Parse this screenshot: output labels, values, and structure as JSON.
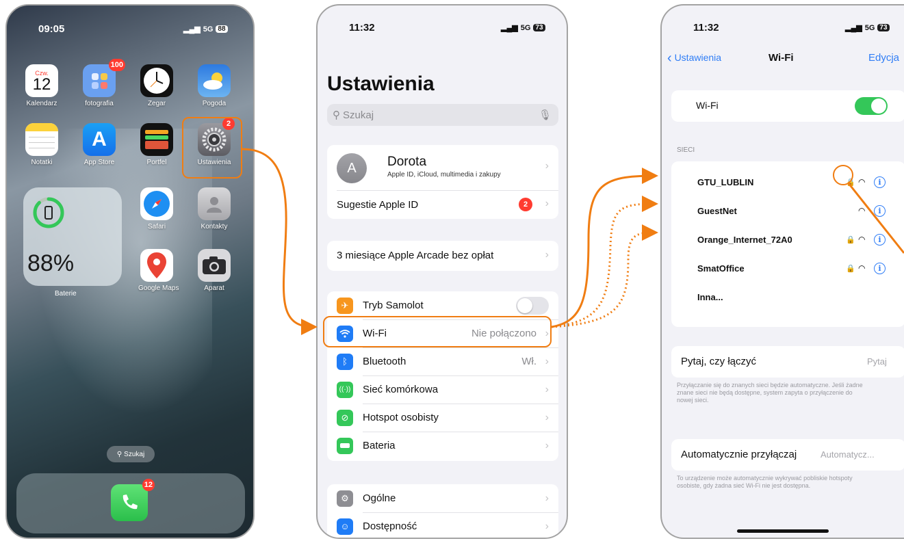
{
  "home": {
    "time": "09:05",
    "signal": "5G",
    "battery": "88",
    "apps": [
      {
        "label": "Kalendarz",
        "day": "Czw.",
        "date": "12"
      },
      {
        "label": "fotografia",
        "badge": "100"
      },
      {
        "label": "Zegar"
      },
      {
        "label": "Pogoda"
      },
      {
        "label": "Notatki"
      },
      {
        "label": "App Store"
      },
      {
        "label": "Portfel"
      },
      {
        "label": "Ustawienia",
        "badge": "2"
      },
      {
        "label": "Safari"
      },
      {
        "label": "Kontakty"
      },
      {
        "label": "Google Maps"
      },
      {
        "label": "Aparat"
      }
    ],
    "battery_widget": {
      "percent": "88%",
      "label": "Baterie",
      "level": 0.88
    },
    "search_pill": "Szukaj",
    "dock": {
      "phone_badge": "12"
    }
  },
  "settings": {
    "time": "11:32",
    "signal": "5G",
    "battery": "73",
    "title": "Ustawienia",
    "search_placeholder": "Szukaj",
    "profile": {
      "initial": "A",
      "name": "Dorota",
      "subtitle": "Apple ID, iCloud, multimedia i zakupy"
    },
    "suggestions": {
      "label": "Sugestie Apple ID",
      "badge": "2"
    },
    "arcade": "3 miesiące Apple Arcade bez opłat",
    "rows": [
      {
        "label": "Tryb Samolot",
        "color": "#f7961e"
      },
      {
        "label": "Wi-Fi",
        "value": "Nie połączono",
        "color": "#1f7cf6"
      },
      {
        "label": "Bluetooth",
        "value": "Wł.",
        "color": "#1f7cf6"
      },
      {
        "label": "Sieć komórkowa",
        "color": "#34c759"
      },
      {
        "label": "Hotspot osobisty",
        "color": "#34c759"
      },
      {
        "label": "Bateria",
        "color": "#34c759"
      }
    ],
    "rows2": [
      {
        "label": "Ogólne",
        "color": "#8e8e93"
      },
      {
        "label": "Dostępność",
        "color": "#1f7cf6"
      }
    ]
  },
  "wifi": {
    "time": "11:32",
    "signal": "5G",
    "battery": "73",
    "back_label": "Ustawienia",
    "title": "Wi-Fi",
    "edit_label": "Edycja",
    "toggle_label": "Wi-Fi",
    "section_header": "SIECI",
    "networks": [
      {
        "name": "GTU_LUBLIN",
        "locked": true
      },
      {
        "name": "GuestNet",
        "locked": false
      },
      {
        "name": "Orange_Internet_72A0",
        "locked": true
      },
      {
        "name": "SmatOffice",
        "locked": true
      }
    ],
    "other": "Inna...",
    "ask_label": "Pytaj, czy łączyć",
    "ask_value": "Pytaj",
    "ask_footer": "Przyłączanie się do znanych sieci będzie automatyczne. Jeśli żadne znane sieci nie będą dostępne, system zapyta o przyłączenie do nowej sieci.",
    "auto_label": "Automatycznie przyłączaj",
    "auto_value": "Automatycz...",
    "auto_footer": "To urządzenie może automatycznie wykrywać pobliskie hotspoty osobiste, gdy żadna sieć Wi-Fi nie jest dostępna."
  },
  "colors": {
    "accent": "#f07d12",
    "ios_blue": "#2f7df6",
    "ios_green": "#34c759",
    "badge_red": "#ff3b30"
  }
}
